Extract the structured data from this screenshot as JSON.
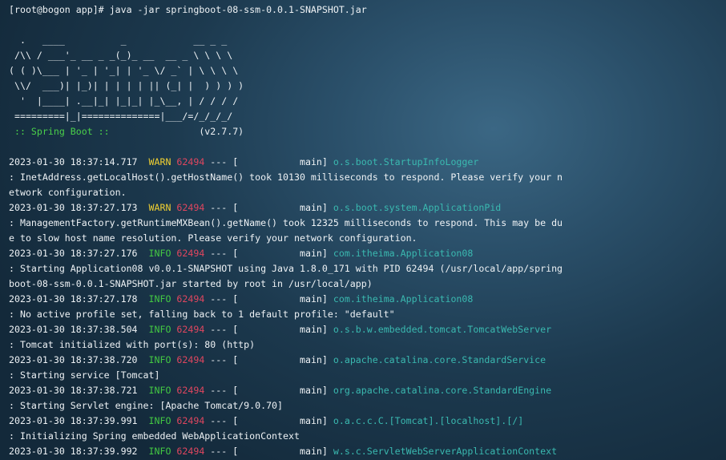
{
  "terminal": {
    "prompt": "[root@bogon app]# java -jar springboot-08-ssm-0.0.1-SNAPSHOT.jar",
    "banner": [
      "  .   ____          _            __ _ _",
      " /\\\\ / ___'_ __ _ _(_)_ __  __ _ \\ \\ \\ \\",
      "( ( )\\___ | '_ | '_| | '_ \\/ _` | \\ \\ \\ \\",
      " \\\\/  ___)| |_)| | | | | || (_| |  ) ) ) )",
      "  '  |____| .__|_| |_|_| |_\\__, | / / / /",
      " =========|_|==============|___/=/_/_/_/"
    ],
    "spring_label": " :: Spring Boot :: ",
    "spring_version": "               (v2.7.7)",
    "logs": [
      {
        "timestamp": "2023-01-30 18:37:14.717",
        "level": "WARN",
        "pid": "62494",
        "sep": " --- [           main] ",
        "logger": "o.s.boot.StartupInfoLogger",
        "message": [
          ": InetAddress.getLocalHost().getHostName() took 10130 milliseconds to respond. Please verify your n",
          "etwork configuration."
        ]
      },
      {
        "timestamp": "2023-01-30 18:37:27.173",
        "level": "WARN",
        "pid": "62494",
        "sep": " --- [           main] ",
        "logger": "o.s.boot.system.ApplicationPid",
        "message": [
          ": ManagementFactory.getRuntimeMXBean().getName() took 12325 milliseconds to respond. This may be du",
          "e to slow host name resolution. Please verify your network configuration."
        ]
      },
      {
        "timestamp": "2023-01-30 18:37:27.176",
        "level": "INFO",
        "pid": "62494",
        "sep": " --- [           main] ",
        "logger": "com.itheima.Application08",
        "message": [
          ": Starting Application08 v0.0.1-SNAPSHOT using Java 1.8.0_171 with PID 62494 (/usr/local/app/spring",
          "boot-08-ssm-0.0.1-SNAPSHOT.jar started by root in /usr/local/app)"
        ]
      },
      {
        "timestamp": "2023-01-30 18:37:27.178",
        "level": "INFO",
        "pid": "62494",
        "sep": " --- [           main] ",
        "logger": "com.itheima.Application08",
        "message": [
          ": No active profile set, falling back to 1 default profile: \"default\""
        ]
      },
      {
        "timestamp": "2023-01-30 18:37:38.504",
        "level": "INFO",
        "pid": "62494",
        "sep": " --- [           main] ",
        "logger": "o.s.b.w.embedded.tomcat.TomcatWebServer",
        "message": [
          ": Tomcat initialized with port(s): 80 (http)"
        ]
      },
      {
        "timestamp": "2023-01-30 18:37:38.720",
        "level": "INFO",
        "pid": "62494",
        "sep": " --- [           main] ",
        "logger": "o.apache.catalina.core.StandardService",
        "message": [
          ": Starting service [Tomcat]"
        ]
      },
      {
        "timestamp": "2023-01-30 18:37:38.721",
        "level": "INFO",
        "pid": "62494",
        "sep": " --- [           main] ",
        "logger": "org.apache.catalina.core.StandardEngine",
        "message": [
          ": Starting Servlet engine: [Apache Tomcat/9.0.70]"
        ]
      },
      {
        "timestamp": "2023-01-30 18:37:39.991",
        "level": "INFO",
        "pid": "62494",
        "sep": " --- [           main] ",
        "logger": "o.a.c.c.C.[Tomcat].[localhost].[/]",
        "message": [
          ": Initializing Spring embedded WebApplicationContext"
        ]
      },
      {
        "timestamp": "2023-01-30 18:37:39.992",
        "level": "INFO",
        "pid": "62494",
        "sep": " --- [           main] ",
        "logger": "w.s.c.ServletWebServerApplicationContext",
        "message": []
      }
    ]
  }
}
